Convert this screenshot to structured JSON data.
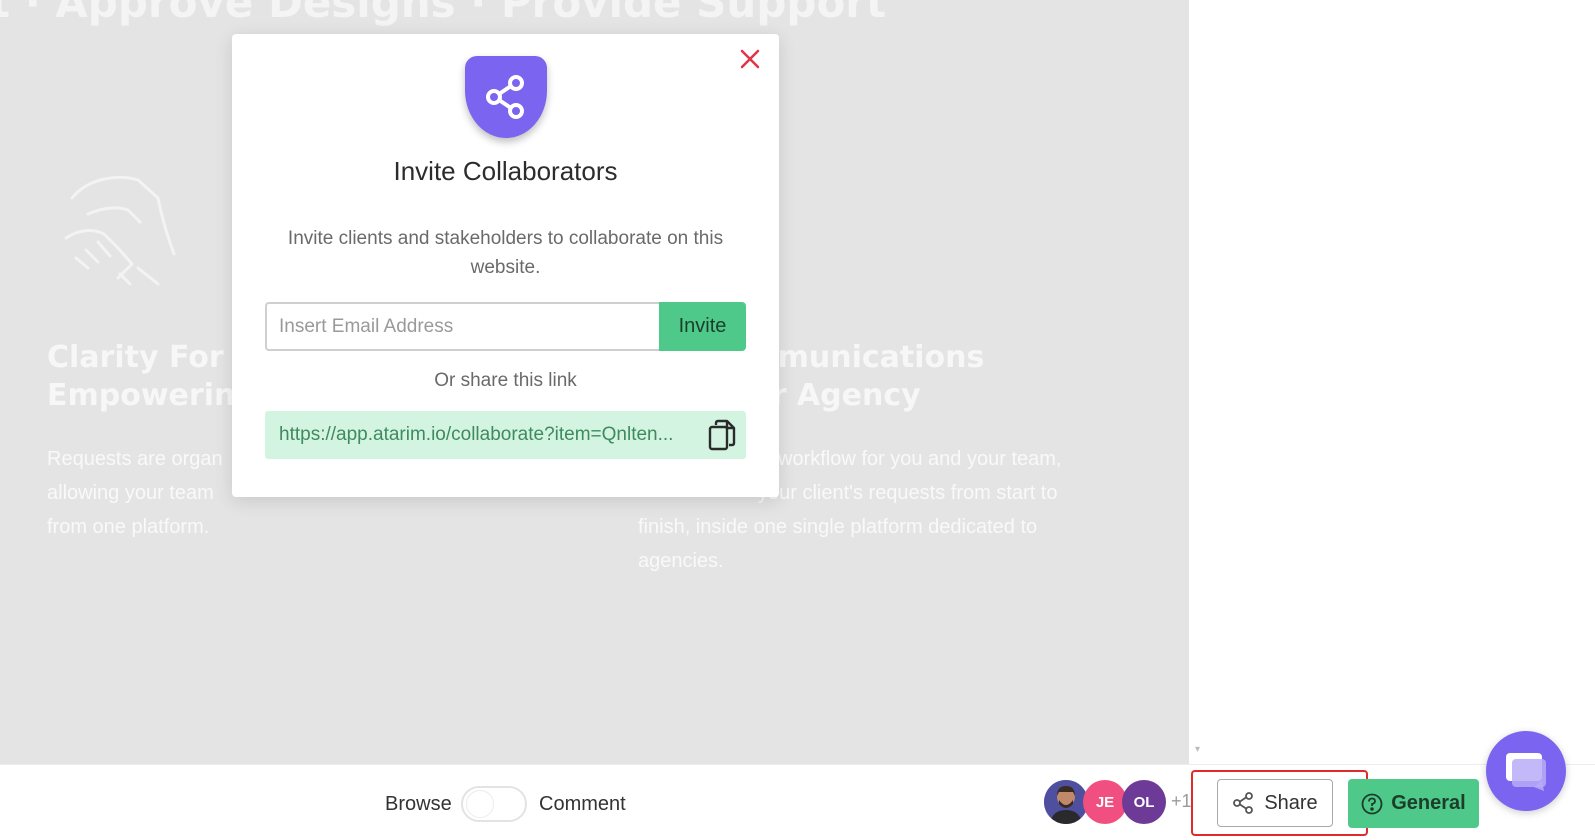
{
  "background_page": {
    "hero_title": "t · Approve Designs · Provide Support",
    "feature_left": {
      "title_lines": [
        "Clarity For",
        "Empowerin"
      ],
      "text_lines": [
        "Requests are organ",
        "allowing your team",
        "from one platform."
      ]
    },
    "feature_right": {
      "title_lines": [
        "zed Communications",
        "out Your Agency"
      ],
      "text_lines": [
        "workflow for you and your team,",
        "your client's requests from start to",
        "finish, inside one single platform dedicated to",
        "agencies."
      ]
    }
  },
  "modal": {
    "title": "Invite Collaborators",
    "description": "Invite clients and stakeholders to collaborate on this website.",
    "email_placeholder": "Insert Email Address",
    "email_value": "",
    "invite_label": "Invite",
    "or_share_label": "Or share this link",
    "share_link": "https://app.atarim.io/collaborate?item=Qnlten...",
    "icons": {
      "header": "share-icon",
      "close": "close-icon",
      "copy": "copy-icon"
    },
    "colors": {
      "accent": "#7b65f0",
      "close": "#e0344a",
      "invite": "#4ec98a",
      "link_bg": "#d4f4e2"
    }
  },
  "bottom_bar": {
    "mode_browse_label": "Browse",
    "mode_comment_label": "Comment",
    "toggle_state": "Browse",
    "avatars": [
      {
        "initials": "",
        "type": "photo"
      },
      {
        "initials": "JE",
        "color": "#f04f7f"
      },
      {
        "initials": "OL",
        "color": "#6e3a98"
      }
    ],
    "more_count": "+1",
    "share_label": "Share",
    "general_label": "General",
    "icons": {
      "share": "share-icon",
      "general": "help-circle-icon",
      "chat": "chat-bubble-icon"
    }
  }
}
